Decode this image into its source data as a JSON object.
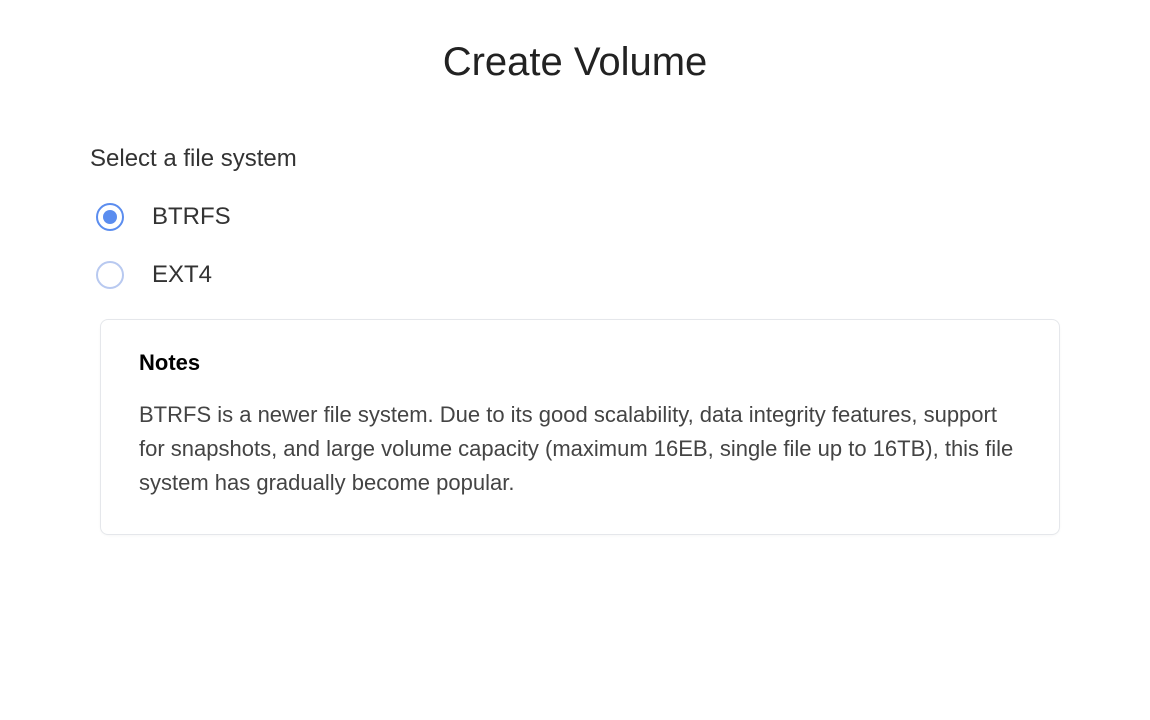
{
  "title": "Create Volume",
  "section_label": "Select a file system",
  "options": [
    {
      "label": "BTRFS",
      "selected": true
    },
    {
      "label": "EXT4",
      "selected": false
    }
  ],
  "notes": {
    "heading": "Notes",
    "body": "BTRFS is a newer file system. Due to its good scalability, data integrity features, support for snapshots, and large volume capacity (maximum 16EB, single file up to 16TB), this file system has gradually become popular."
  }
}
